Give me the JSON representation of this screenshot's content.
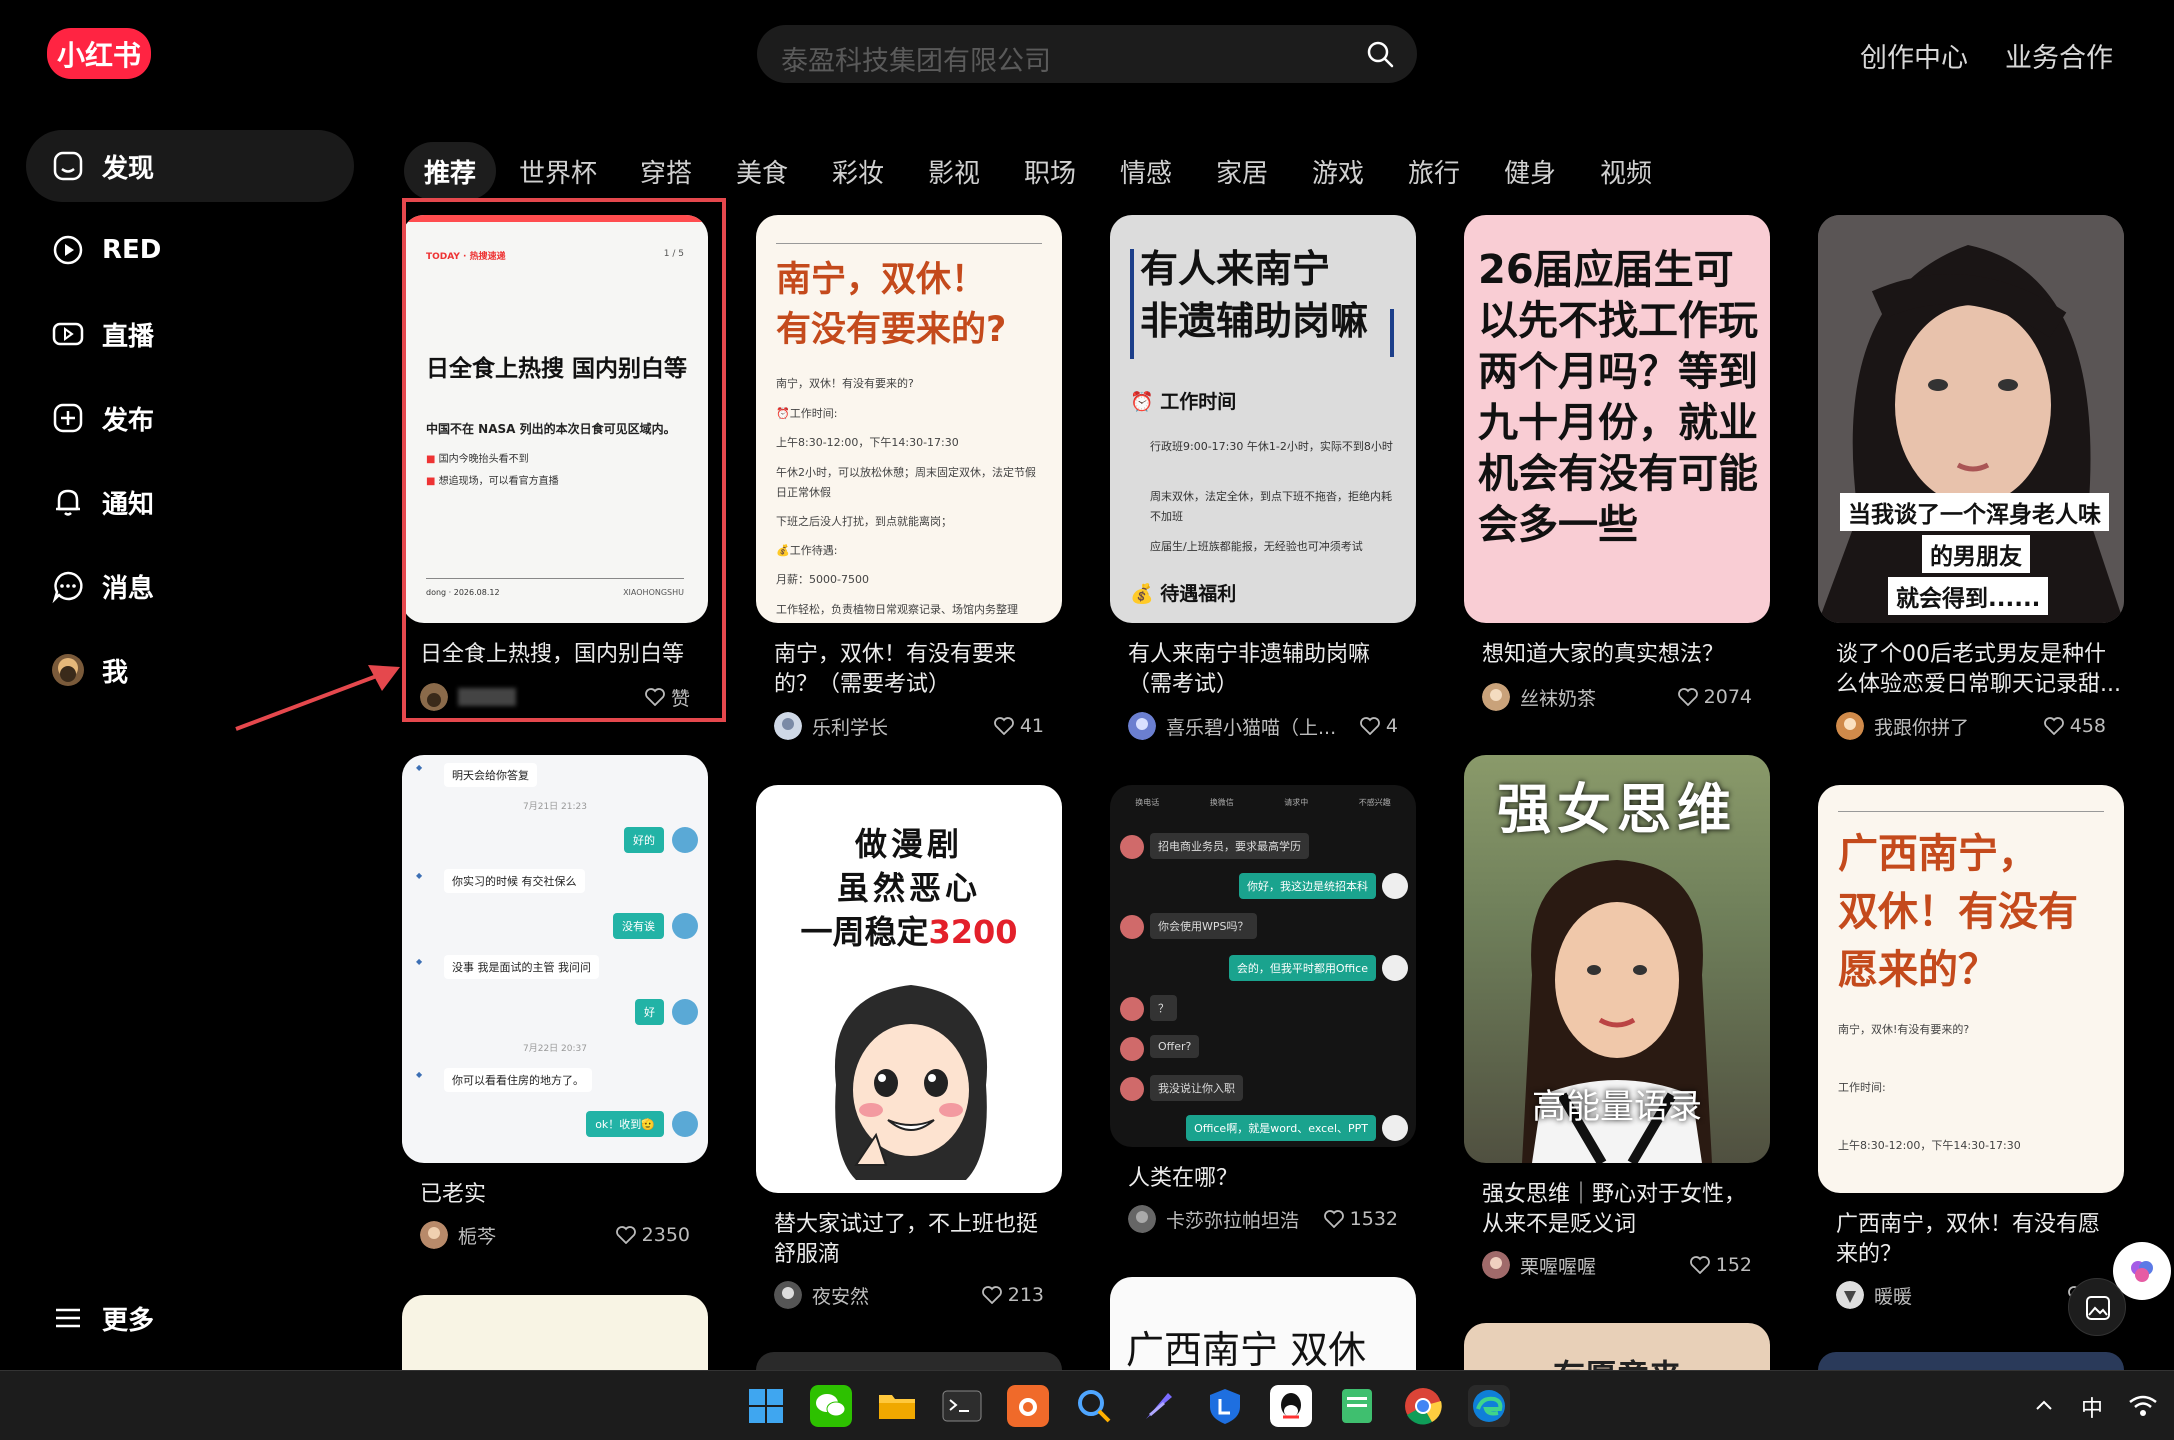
{
  "header": {
    "logo": "小红书",
    "search_placeholder": "泰盈科技集团有限公司",
    "nav": [
      "创作中心",
      "业务合作"
    ]
  },
  "sidebar": {
    "items": [
      "发现",
      "RED",
      "直播",
      "发布",
      "通知",
      "消息",
      "我"
    ],
    "more": "更多"
  },
  "tabs": [
    "推荐",
    "世界杯",
    "穿搭",
    "美食",
    "彩妆",
    "影视",
    "职场",
    "情感",
    "家居",
    "游戏",
    "旅行",
    "健身",
    "视频"
  ],
  "cards": {
    "c1": {
      "thumb": {
        "tag": "TODAY · 热搜速递",
        "page": "1 / 5",
        "headline": "日全食上热搜 国内别白等",
        "sub": "中国不在 NASA 列出的本次日食可见区域内。",
        "bullets": [
          "国内今晚抬头看不到",
          "想追现场，可以看官方直播"
        ],
        "footer_left": "dong · 2026.08.12",
        "footer_right": "XIAOHONGSHU"
      },
      "title": "日全食上热搜，国内别白等",
      "likes": "赞"
    },
    "c2": {
      "thumb": {
        "headline1": "南宁，双休！",
        "headline2": "有没有要来的?",
        "lines": [
          "南宁，双休！有没有要来的?",
          "⏰工作时间:",
          "上午8:30-12:00，下午14:30-17:30",
          "午休2小时，可以放松休憩；周末固定双休，法定节假日正常休假",
          "下班之后没人打扰，到点就能离岗；",
          "💰工作待遇:",
          "月薪：5000-7500",
          "工作轻松，负责植物日常观察记录、场馆内务整理"
        ]
      },
      "title": "南宁，双休！有没有要来的？（需要考试）",
      "author": "乐利学长",
      "likes": "41"
    },
    "c3": {
      "thumb": {
        "headline1": "有人来南宁",
        "headline2": "非遗辅助岗嘛",
        "sec1": "⏰ 工作时间",
        "lines1": [
          "行政班9:00-17:30 午休1-2小时，实际不到8小时",
          "周末双休，法定全休，到点下班不拖沓，拒绝内耗不加班",
          "应届生/上班族都能报，无经验也可冲须考试"
        ],
        "sec2": "💰 待遇福利"
      },
      "title": "有人来南宁非遗辅助岗嘛（需考试）",
      "author": "喜乐碧小猫喵（上...",
      "likes": "4"
    },
    "c4": {
      "thumb": {
        "text": "26届应届生可以先不找工作玩两个月吗？等到九十月份，就业机会有没有可能会多一些"
      },
      "title": "想知道大家的真实想法？",
      "author": "丝袜奶茶",
      "likes": "2074"
    },
    "c5": {
      "thumb": {
        "caption": [
          "当我谈了一个浑身老人味",
          "的男朋友",
          "就会得到......"
        ]
      },
      "title": "谈了个00后老式男友是种什么体验恋爱日常聊天记录甜...",
      "author": "我跟你拼了",
      "likes": "458"
    },
    "c6": {
      "thumb": {
        "msgs": [
          {
            "side": "l",
            "text": "明天会给你答复"
          },
          {
            "side": "t",
            "text": "7月21日 21:23"
          },
          {
            "side": "r",
            "text": "好的"
          },
          {
            "side": "l",
            "text": "你实习的时候 有交社保么"
          },
          {
            "side": "r",
            "text": "没有诶"
          },
          {
            "side": "l",
            "text": "没事 我是面试的主管 我问问"
          },
          {
            "side": "r",
            "text": "好"
          },
          {
            "side": "t",
            "text": "7月22日 20:37"
          },
          {
            "side": "l",
            "text": "你可以看看住房的地方了。"
          },
          {
            "side": "r",
            "text": "ok！收到🫡"
          }
        ]
      },
      "title": "已老实",
      "author": "栀芩",
      "likes": "2350"
    },
    "c7": {
      "thumb": {
        "line1": "做漫剧",
        "line2": "虽然恶心",
        "line3a": "一周稳定",
        "line3b": "3200"
      },
      "title": "替大家试过了，不上班也挺舒服滴",
      "author": "夜安然",
      "likes": "213"
    },
    "c8": {
      "thumb": {
        "tabs": [
          "换电话",
          "换微信",
          "请求中",
          "不感兴趣"
        ],
        "msgs": [
          {
            "side": "l",
            "text": "招电商业务员，要求最高学历"
          },
          {
            "side": "r",
            "text": "你好，我这边是统招本科"
          },
          {
            "side": "l",
            "text": "你会使用WPS吗？"
          },
          {
            "side": "r",
            "text": "会的，但我平时都用Office"
          },
          {
            "side": "l",
            "text": "？"
          },
          {
            "side": "l",
            "text": "Offer?"
          },
          {
            "side": "l",
            "text": "我没说让你入职"
          },
          {
            "side": "r",
            "text": "Office啊，就是word、excel、PPT"
          }
        ]
      },
      "title": "人类在哪？",
      "author": "卡莎弥拉帕坦浩",
      "likes": "1532"
    },
    "c9": {
      "thumb": {
        "top": "强女思维",
        "bottom": "高能量语录"
      },
      "title": "强女思维｜野心对于女性，从来不是贬义词",
      "author": "栗喔喔喔",
      "likes": "152"
    },
    "c10": {
      "thumb": {
        "headline1": "广西南宁，",
        "headline2": "双休！有没有",
        "headline3": "愿来的？",
        "lines": [
          "南宁，双休!有没有要来的?",
          "工作时间:",
          "上午8:30-12:00，下午14:30-17:30"
        ]
      },
      "title": "广西南宁，双休！有没有愿来的？",
      "author": "暖暖",
      "likes": "1"
    },
    "c11": {
      "headline": "广西南宁 双休"
    },
    "c12": {
      "headline": "有愿意来"
    }
  },
  "taskbar": {
    "ime": "中"
  },
  "colors": {
    "accent": "#ff2442",
    "highlight_box": "#e5484d"
  }
}
